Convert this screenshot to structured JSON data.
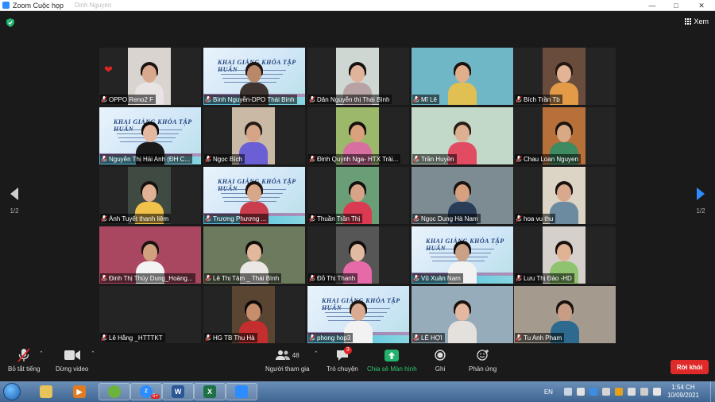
{
  "window": {
    "title": "Zoom Cuộc họp",
    "subtitle": "Dinh Nguyen"
  },
  "view_button": "Xem",
  "pager": {
    "left": "1/2",
    "right": "1/2"
  },
  "participants": [
    {
      "name": "OPPO Reno2 F"
    },
    {
      "name": "Bình Nguyễn-DPO Thái Bình"
    },
    {
      "name": "Dân Nguyễn thị Thái Bình"
    },
    {
      "name": "Mĩ Lê"
    },
    {
      "name": "Bích Trần Tb"
    },
    {
      "name": "Nguyễn Thị Hải Anh (ĐH C..."
    },
    {
      "name": "Ngọc Bích"
    },
    {
      "name": "Đinh Quỳnh Nga- HTX Trải..."
    },
    {
      "name": "Trần Huyền"
    },
    {
      "name": "Chau Loan Nguyen"
    },
    {
      "name": "Ánh Tuyết thanh liêm"
    },
    {
      "name": "Trương Phương ..."
    },
    {
      "name": "Thuần Trần Thị"
    },
    {
      "name": "Ngọc Dung Hà Nam"
    },
    {
      "name": "hoa vu thu"
    },
    {
      "name": "Đinh Thị Thúy Dung_Hoàng..."
    },
    {
      "name": "Lê Thị Tâm _ Thái Bình"
    },
    {
      "name": "Đỗ Thị Thanh"
    },
    {
      "name": "Vũ Xuân Nam"
    },
    {
      "name": "Lưu Thị Đào -HD"
    },
    {
      "name": "Lê Hằng _HTTTKT"
    },
    {
      "name": "HG TB Thu Hà"
    },
    {
      "name": "phong hop3"
    },
    {
      "name": "LÊ HỢI"
    },
    {
      "name": "Tu Anh Pham"
    }
  ],
  "slide_title": "KHAI GIẢNG KHÓA TẬP HUẤN",
  "toolbar": {
    "mute_all": "Bỏ tắt tiếng",
    "stop_video": "Dừng video",
    "participants": "Người tham gia",
    "participants_count": "48",
    "chat": "Trò chuyện",
    "chat_badge": "3",
    "share": "Chia sẻ Màn hình",
    "record": "Ghi",
    "reactions": "Phản ứng",
    "leave": "Rời khỏi"
  },
  "taskbar": {
    "lang": "EN",
    "time": "1:54 CH",
    "date": "10/09/2021",
    "zoom_badge": "5+"
  }
}
